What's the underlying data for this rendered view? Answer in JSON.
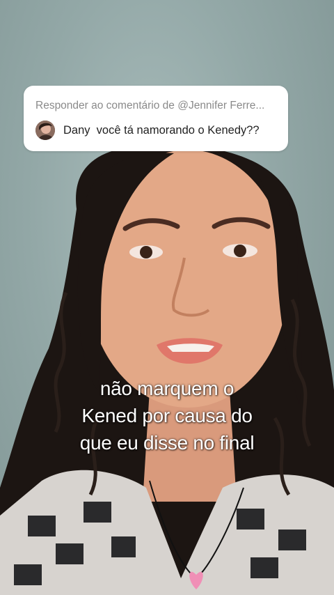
{
  "reply_sticker": {
    "header": "Responder ao comentário de @Jennifer Ferre...",
    "comment": "Dany  você tá namorando o Kenedy??"
  },
  "caption": {
    "lines": [
      "não marquem o",
      "Kened por causa do",
      "que eu disse no final"
    ]
  },
  "colors": {
    "background_wall": "#93a8a7",
    "card_background": "#ffffff",
    "header_text": "#8a8a8a",
    "comment_text": "#222222",
    "caption_text": "#ffffff"
  }
}
